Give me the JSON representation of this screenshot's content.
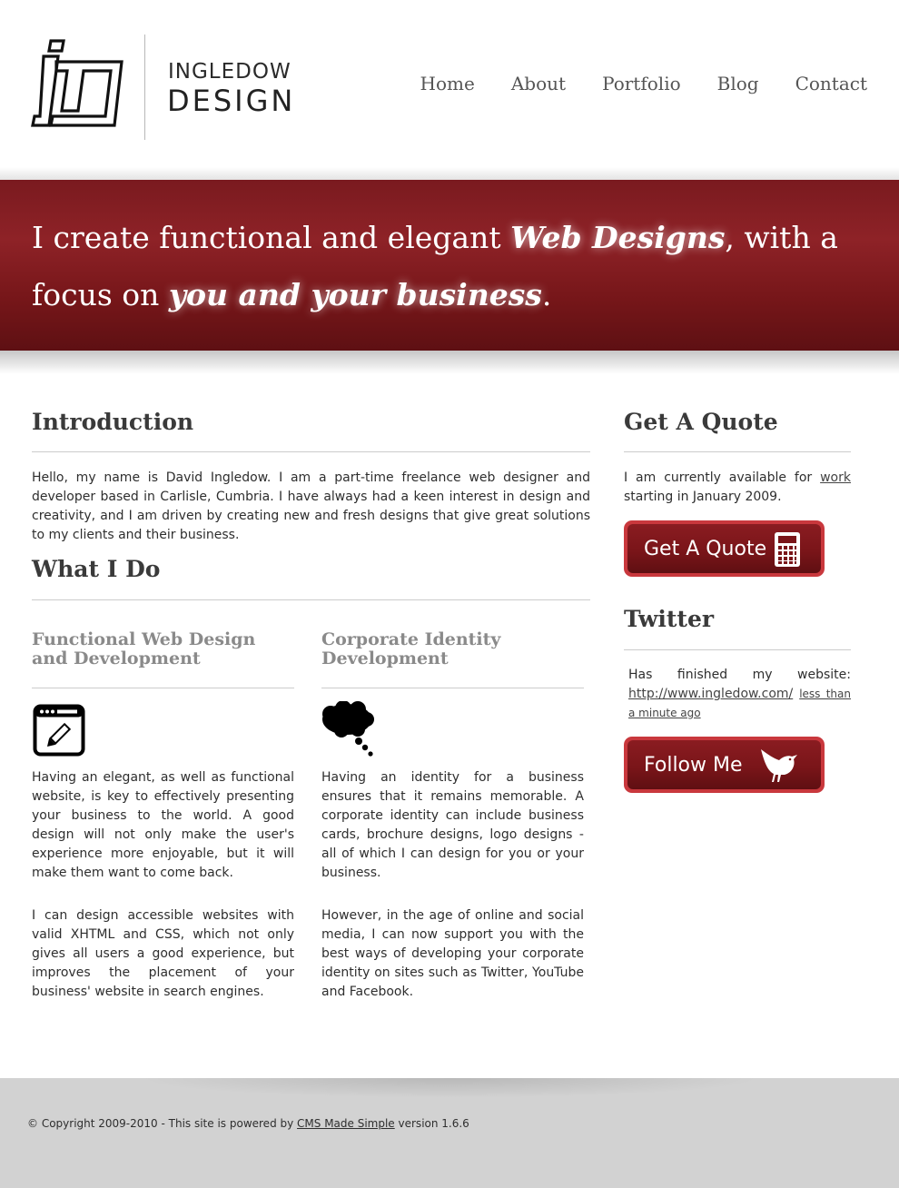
{
  "header": {
    "logo_line1": "INGLEDOW",
    "logo_line2": "DESIGN",
    "nav": [
      "Home",
      "About",
      "Portfolio",
      "Blog",
      "Contact"
    ]
  },
  "banner": {
    "part1": "I create functional and elegant ",
    "em1": "Web Designs",
    "part2": ", with a focus on ",
    "em2": "you and your business",
    "part3": "."
  },
  "intro": {
    "title": "Introduction",
    "text": "Hello, my name is David Ingledow. I am a part-time freelance web designer and developer based in Carlisle, Cumbria. I have always had a keen interest in design and creativity, and I am driven by creating new and fresh designs that give great solutions to my clients and their business."
  },
  "what_i_do": {
    "title": "What I Do",
    "col1": {
      "title": "Functional Web Design and Development",
      "icon": "browser-pencil-icon",
      "p1": "Having an elegant, as well as functional website, is key to effectively presenting your business to the world. A good design will not only make the user's experience more enjoyable, but it will make them want to come back.",
      "p2": "I can design accessible websites with valid XHTML and CSS, which not only gives all users a good experience, but improves the placement of your business' website in search engines."
    },
    "col2": {
      "title": "Corporate Identity Development",
      "icon": "thought-cloud-icon",
      "p1": "Having an identity for a business ensures that it remains memorable. A corporate identity can include business cards, brochure designs, logo designs - all of which I can design for you or your business.",
      "p2": "However, in the age of online and social media, I can now support you with the best ways of developing your corporate identity on sites such as Twitter, YouTube and Facebook."
    }
  },
  "quote": {
    "title": "Get A Quote",
    "text_before": "I am currently available for ",
    "link": "work",
    "text_after": " starting in January 2009.",
    "button": "Get A Quote"
  },
  "twitter": {
    "title": "Twitter",
    "tweet": "Has finished my website: ",
    "url": "http://www.ingledow.com/",
    "time": "less than a minute ago",
    "button": "Follow Me"
  },
  "footer": {
    "text_before": "© Copyright 2009-2010 - This site is powered by ",
    "link": "CMS Made Simple",
    "text_after": " version 1.6.6"
  },
  "colors": {
    "banner_red": "#8e2227",
    "button_border": "#c9383d",
    "footer_bg": "#d2d2d2"
  }
}
